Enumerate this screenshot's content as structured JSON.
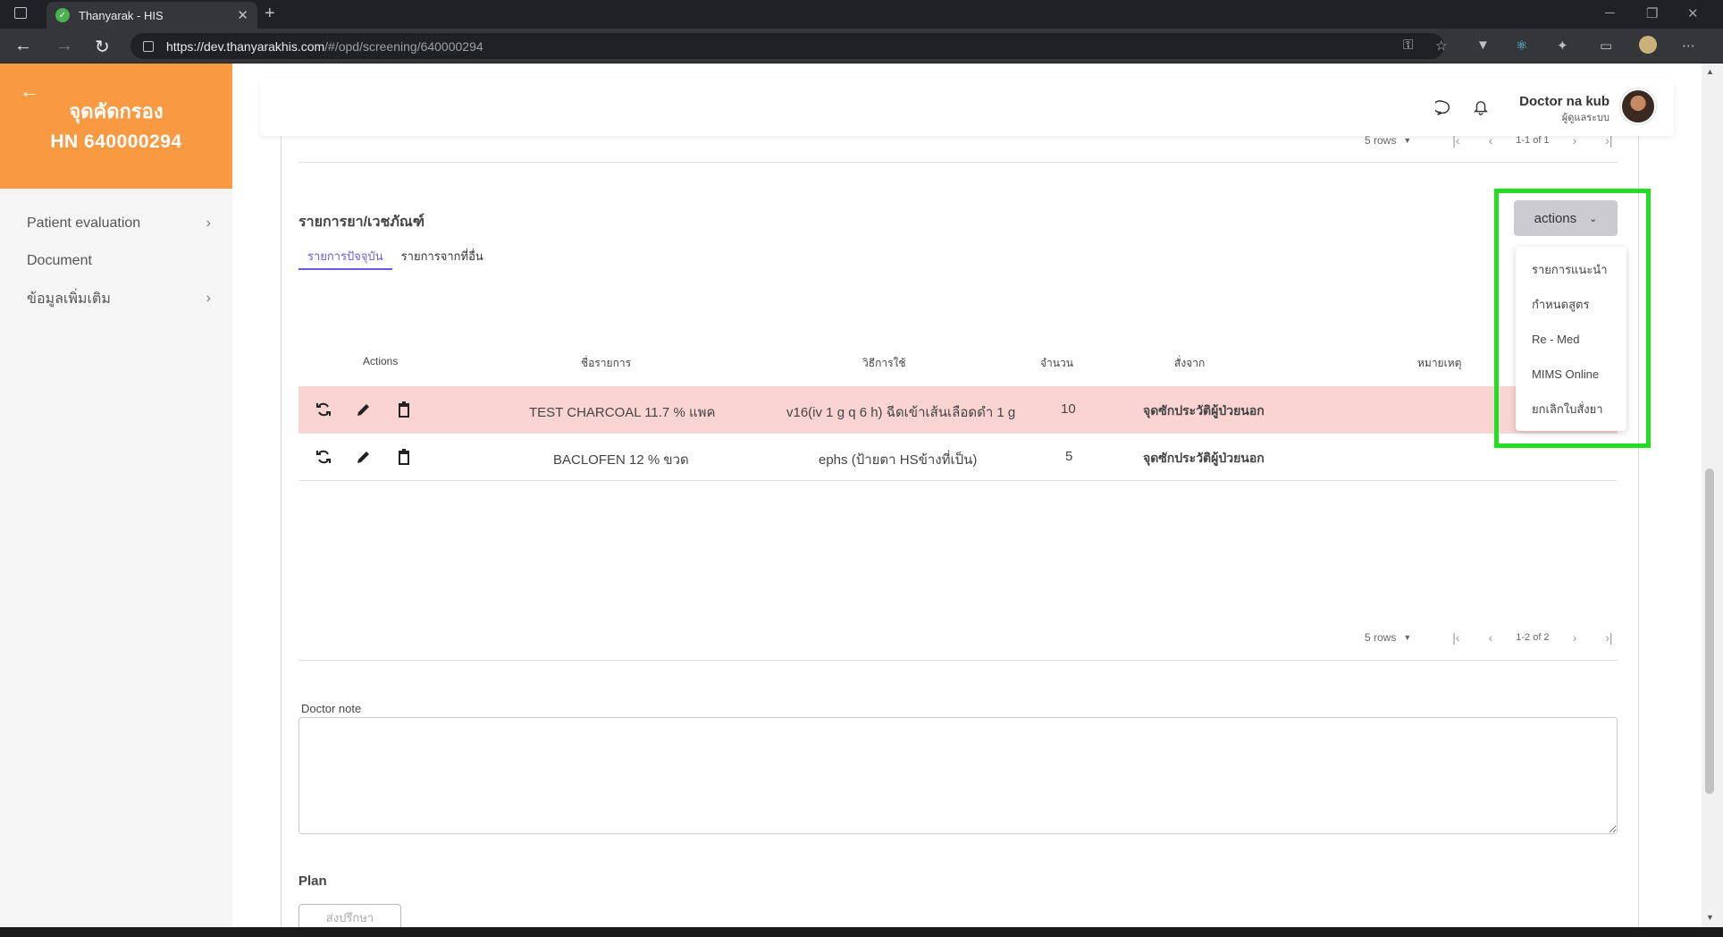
{
  "browser": {
    "tab_title": "Thanyarak - HIS",
    "tab_close": "✕",
    "new_tab": "+",
    "url_host": "https://dev.thanyarakhis.com",
    "url_path": "/#/opd/screening/640000294"
  },
  "sidebar": {
    "title": "จุดคัดกรอง",
    "hn": "HN 640000294",
    "items": [
      {
        "label": "Patient evaluation",
        "has_submenu": true
      },
      {
        "label": "Document",
        "has_submenu": false
      },
      {
        "label": "ข้อมูลเพิ่มเติม",
        "has_submenu": true
      }
    ]
  },
  "header": {
    "user_name": "Doctor na kub",
    "user_role": "ผู้ดูแลระบบ"
  },
  "top_pager": {
    "rows": "5 rows",
    "range": "1-1 of 1"
  },
  "medications": {
    "title": "รายการยา/เวชภัณฑ์",
    "tabs": [
      {
        "label": "รายการปัจจุบัน",
        "active": true
      },
      {
        "label": "รายการจากที่อื่น",
        "active": false
      }
    ],
    "columns": [
      "Actions",
      "ชื่อรายการ",
      "วิธีการใช้",
      "จำนวน",
      "สั่งจาก",
      "หมายเหตุ"
    ],
    "rows": [
      {
        "name": "TEST CHARCOAL 11.7 % แพค",
        "usage": "v16(iv 1 g q 6 h) ฉีดเข้าเส้นเลือดดำ 1 g",
        "qty": "10",
        "ordered_from": "จุดซักประวัติผู้ป่วยนอก",
        "note": "",
        "highlighted": true
      },
      {
        "name": "BACLOFEN 12 % ขวด",
        "usage": "ephs (ป้ายตา HSข้างที่เป็น)",
        "qty": "5",
        "ordered_from": "จุดซักประวัติผู้ป่วยนอก",
        "note": "",
        "highlighted": false
      }
    ],
    "pager": {
      "rows": "5 rows",
      "range": "1-2 of 2"
    }
  },
  "actions_menu": {
    "button_label": "actions",
    "options": [
      "รายการแนะนำ",
      "กำหนดสูตร",
      "Re - Med",
      "MIMS Online",
      "ยกเลิกใบสั่งยา"
    ],
    "highlight_color": "#22dd22"
  },
  "doctor_note": {
    "label": "Doctor note",
    "value": ""
  },
  "plan": {
    "label": "Plan",
    "button_label": "ส่งปรึกษา"
  },
  "colors": {
    "brand": "#f99a42",
    "accent": "#6b5ce7",
    "row_highlight": "#f9d4d3"
  }
}
